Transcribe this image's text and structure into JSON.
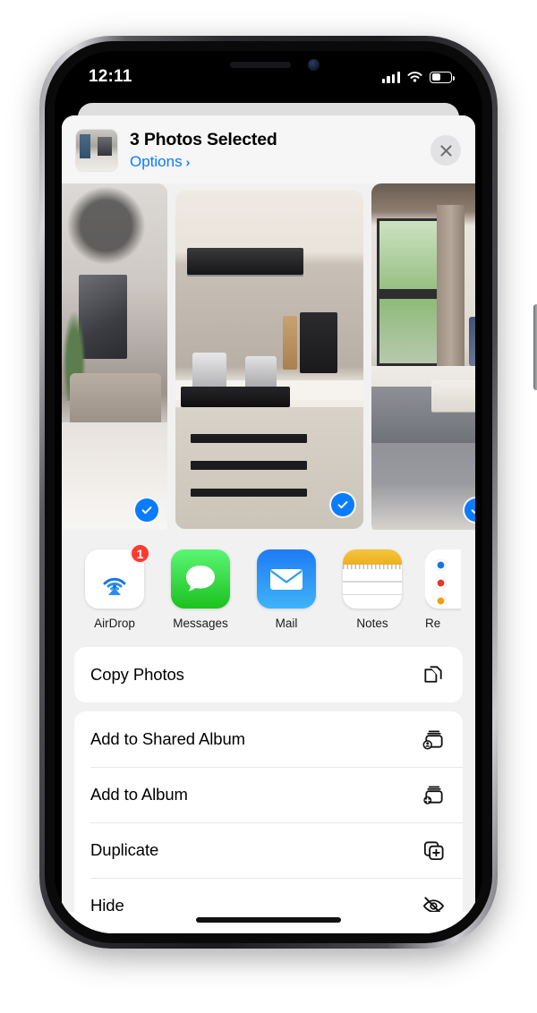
{
  "status_bar": {
    "time": "12:11",
    "cellular_icon": "cellular-bars-icon",
    "wifi_icon": "wifi-icon",
    "battery_icon": "battery-icon"
  },
  "share_sheet": {
    "header": {
      "thumbnail_alt": "selected-photo-thumbnail",
      "title": "3 Photos Selected",
      "options_label": "Options",
      "options_chevron": "›",
      "close_icon": "close-icon"
    },
    "photos": [
      {
        "name": "living-room-photo",
        "selected": true
      },
      {
        "name": "kitchen-photo",
        "selected": true
      },
      {
        "name": "bedroom-balcony-photo",
        "selected": true
      }
    ],
    "apps": [
      {
        "label": "AirDrop",
        "icon": "airdrop-icon",
        "badge": "1"
      },
      {
        "label": "Messages",
        "icon": "messages-icon",
        "badge": ""
      },
      {
        "label": "Mail",
        "icon": "mail-icon",
        "badge": ""
      },
      {
        "label": "Notes",
        "icon": "notes-icon",
        "badge": ""
      },
      {
        "label": "Re",
        "icon": "reminders-icon",
        "badge": ""
      }
    ],
    "action_groups": [
      {
        "rows": [
          {
            "label": "Copy Photos",
            "icon": "copy-icon"
          }
        ]
      },
      {
        "rows": [
          {
            "label": "Add to Shared Album",
            "icon": "shared-album-icon"
          },
          {
            "label": "Add to Album",
            "icon": "add-album-icon"
          },
          {
            "label": "Duplicate",
            "icon": "duplicate-icon"
          },
          {
            "label": "Hide",
            "icon": "hide-eye-slash-icon"
          }
        ]
      }
    ]
  },
  "colors": {
    "accent_blue": "#0a7cff",
    "badge_red": "#ff3b30",
    "sheet_bg": "#f1f1f1",
    "row_bg": "#ffffff"
  }
}
